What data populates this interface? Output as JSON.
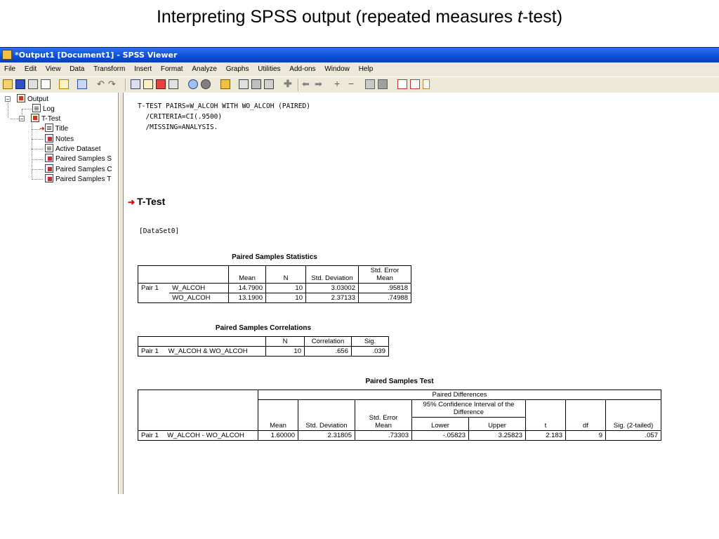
{
  "slide": {
    "title_main": "Interpreting SPSS output (repeated measures ",
    "title_italic": "t",
    "title_end": "-test)"
  },
  "window": {
    "title": "*Output1 [Document1] - SPSS Viewer"
  },
  "menu": [
    {
      "label": "File"
    },
    {
      "label": "Edit"
    },
    {
      "label": "View"
    },
    {
      "label": "Data"
    },
    {
      "label": "Transform"
    },
    {
      "label": "Insert"
    },
    {
      "label": "Format"
    },
    {
      "label": "Analyze"
    },
    {
      "label": "Graphs"
    },
    {
      "label": "Utilities"
    },
    {
      "label": "Add-ons"
    },
    {
      "label": "Window"
    },
    {
      "label": "Help"
    }
  ],
  "tree": {
    "output": "Output",
    "log": "Log",
    "ttest": "T-Test",
    "title": "Title",
    "notes": "Notes",
    "active_dataset": "Active Dataset",
    "paired_s": "Paired Samples S",
    "paired_c": "Paired Samples C",
    "paired_t": "Paired Samples T"
  },
  "syntax": {
    "line1": "T-TEST PAIRS=W_ALCOH WITH WO_ALCOH (PAIRED)",
    "line2": "  /CRITERIA=CI(.9500)",
    "line3": "  /MISSING=ANALYSIS."
  },
  "heading": "T-Test",
  "dataset": "[DataSet0]",
  "stats": {
    "caption": "Paired Samples Statistics",
    "h_mean": "Mean",
    "h_n": "N",
    "h_sd": "Std. Deviation",
    "h_se1": "Std. Error",
    "h_se2": "Mean",
    "pair": "Pair 1",
    "r1": {
      "var": "W_ALCOH",
      "mean": "14.7900",
      "n": "10",
      "sd": "3.03002",
      "se": ".95818"
    },
    "r2": {
      "var": "WO_ALCOH",
      "mean": "13.1900",
      "n": "10",
      "sd": "2.37133",
      "se": ".74988"
    }
  },
  "corr": {
    "caption": "Paired Samples Correlations",
    "h_n": "N",
    "h_corr": "Correlation",
    "h_sig": "Sig.",
    "pair": "Pair 1",
    "var": "W_ALCOH & WO_ALCOH",
    "n": "10",
    "corr": ".656",
    "sig": ".039"
  },
  "test": {
    "caption": "Paired Samples Test",
    "h_pd": "Paired Differences",
    "h_ci": "95% Confidence Interval of the Difference",
    "h_mean": "Mean",
    "h_sd": "Std. Deviation",
    "h_se1": "Std. Error",
    "h_se2": "Mean",
    "h_lower": "Lower",
    "h_upper": "Upper",
    "h_t": "t",
    "h_df": "df",
    "h_sig": "Sig. (2-tailed)",
    "pair": "Pair 1",
    "var": "W_ALCOH - WO_ALCOH",
    "mean": "1.60000",
    "sd": "2.31805",
    "se": ".73303",
    "lower": "-.05823",
    "upper": "3.25823",
    "t": "2.183",
    "df": "9",
    "sig": ".057"
  },
  "icons": [
    "open-icon",
    "save-icon",
    "print-icon",
    "print-preview-icon",
    "export-icon",
    "dialog-recall-icon",
    "undo-icon",
    "redo-icon",
    "goto-data-icon",
    "goto-case-icon",
    "variables-icon",
    "use-sets-icon",
    "show-all-icon",
    "insert-cases-icon",
    "insert-variables-icon",
    "split-file-icon",
    "weight-cases-icon",
    "select-cases-icon",
    "value-labels-icon",
    "back-icon",
    "forward-icon",
    "expand-icon",
    "collapse-icon",
    "show-icon",
    "hide-icon",
    "insert-heading-icon",
    "insert-title-icon",
    "insert-text-icon"
  ],
  "colors": {
    "titlebar": "#0a4fd6",
    "arrow": "#e00000",
    "chrome": "#ece9d8"
  }
}
